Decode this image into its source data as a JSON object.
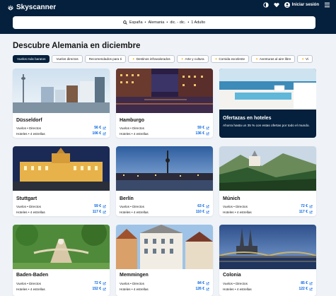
{
  "header": {
    "brand": "Skyscanner",
    "login_label": "Iniciar sesión"
  },
  "search": {
    "origin": "España",
    "destination": "Alemania",
    "dates": "dic. - dic.",
    "travellers": "1 Adulto",
    "separator": "•"
  },
  "page_title": "Descubre Alemania en diciembre",
  "chips": [
    {
      "label": "Vuelos más baratos",
      "active": true,
      "icon": ""
    },
    {
      "label": "Vuelos directos",
      "active": false,
      "icon": ""
    },
    {
      "label": "Recomendados para ti",
      "active": false,
      "icon": ""
    },
    {
      "label": "Destinos infravalorados",
      "active": false,
      "icon": "star-icon"
    },
    {
      "label": "Arte y cultura",
      "active": false,
      "icon": "star-icon"
    },
    {
      "label": "Comida excelente",
      "active": false,
      "icon": "star-icon"
    },
    {
      "label": "Aventuras al aire libre",
      "active": false,
      "icon": "star-icon"
    },
    {
      "label": "Vi",
      "active": false,
      "icon": "star-icon"
    }
  ],
  "cards": [
    {
      "name": "Düsseldorf",
      "flights_label": "Vuelos",
      "flights_type": "Directos",
      "flight_price": "56 €",
      "hotels_label": "Hoteles",
      "hotel_stars": "4 estrellas",
      "hotel_price": "106 €"
    },
    {
      "name": "Hamburgo",
      "flights_label": "Vuelos",
      "flights_type": "Directos",
      "flight_price": "59 €",
      "hotels_label": "Hoteles",
      "hotel_stars": "4 estrellas",
      "hotel_price": "136 €"
    },
    {
      "name": "Stuttgart",
      "flights_label": "Vuelos",
      "flights_type": "Directos",
      "flight_price": "59 €",
      "hotels_label": "Hoteles",
      "hotel_stars": "4 estrellas",
      "hotel_price": "117 €"
    },
    {
      "name": "Berlín",
      "flights_label": "Vuelos",
      "flights_type": "Directos",
      "flight_price": "63 €",
      "hotels_label": "Hoteles",
      "hotel_stars": "4 estrellas",
      "hotel_price": "110 €"
    },
    {
      "name": "Múnich",
      "flights_label": "Vuelos",
      "flights_type": "Directos",
      "flight_price": "72 €",
      "hotels_label": "Hoteles",
      "hotel_stars": "4 estrellas",
      "hotel_price": "117 €"
    },
    {
      "name": "Baden-Baden",
      "flights_label": "Vuelos",
      "flights_type": "Directos",
      "flight_price": "72 €",
      "hotels_label": "Hoteles",
      "hotel_stars": "4 estrellas",
      "hotel_price": "152 €"
    },
    {
      "name": "Memmingen",
      "flights_label": "Vuelos",
      "flights_type": "Directos",
      "flight_price": "84 €",
      "hotels_label": "Hoteles",
      "hotel_stars": "4 estrellas",
      "hotel_price": "126 €"
    },
    {
      "name": "Colonia",
      "flights_label": "Vuelos",
      "flights_type": "Directos",
      "flight_price": "85 €",
      "hotels_label": "Hoteles",
      "hotel_stars": "4 estrellas",
      "hotel_price": "122 €"
    }
  ],
  "promo": {
    "title": "Ofertazas en hoteles",
    "text": "Ahorra hasta un 35 % con estas ofertas por todo el mundo."
  },
  "colors": {
    "header_bg": "#05203c",
    "price_blue": "#0062e3",
    "page_bg": "#eff3f8"
  }
}
